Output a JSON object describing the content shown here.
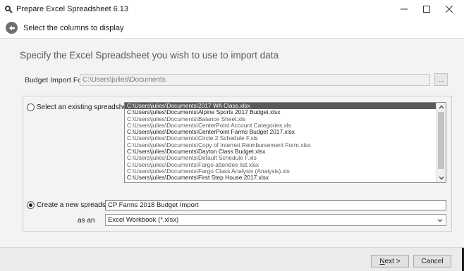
{
  "window": {
    "title": "Prepare Excel Spreadsheet 6.13",
    "app_icon": "magnifier-app-icon",
    "controls": [
      "minimize-icon",
      "maximize-icon",
      "close-icon"
    ]
  },
  "header": {
    "back_icon": "back-arrow-icon",
    "text": "Select the columns to display"
  },
  "main": {
    "heading": "Specify the Excel Spreadsheet you wish to use to import data",
    "folder": {
      "label": "Budget Import Folder",
      "value": "C:\\Users\\julies\\Documents",
      "browse_label": "..."
    },
    "existing": {
      "label": "Select an existing spreadsheet",
      "selected": false,
      "files": [
        "C:\\Users\\julies\\Documents\\2017 WA Class.xlsx",
        "C:\\Users\\julies\\Documents\\Alpine Sports 2017 Budget.xlsx",
        "C:\\Users\\julies\\Documents\\Balance Sheet.xls",
        "C:\\Users\\julies\\Documents\\CenterPoint Account Categories.xls",
        "C:\\Users\\julies\\Documents\\CenterPoint Farms Budget 2017.xlsx",
        "C:\\Users\\julies\\Documents\\Circle 2 Schedule F.xls",
        "C:\\Users\\julies\\Documents\\Copy of Internet Reimbursement Form.xlsx",
        "C:\\Users\\julies\\Documents\\Dayton Class Budget.xlsx",
        "C:\\Users\\julies\\Documents\\Default Schedule F.xls",
        "C:\\Users\\julies\\Documents\\Fargo attendee list.xlsx",
        "C:\\Users\\julies\\Documents\\Fargo Class Analysis (Analysis).xls",
        "C:\\Users\\julies\\Documents\\First Step House 2017.xlsx"
      ],
      "selected_index": 0
    },
    "create_new": {
      "label": "Create a new spreadsheet",
      "selected": true,
      "name_value": "CP Farms 2018 Budget Import",
      "as_label": "as an",
      "type_value": "Excel Workbook (*.xlsx)"
    }
  },
  "footer": {
    "next_label": "Next >",
    "cancel_label": "Cancel"
  },
  "colors": {
    "selection": "#5a5a5a",
    "panel": "#f3f3f3",
    "footer": "#ebebeb"
  }
}
